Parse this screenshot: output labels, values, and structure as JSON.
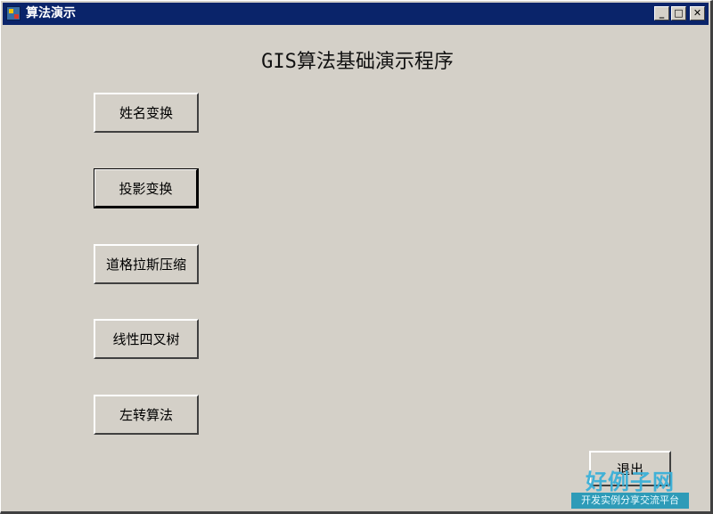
{
  "window": {
    "title": "算法演示",
    "controls": {
      "minimize": "_",
      "maximize": "□",
      "close": "✕"
    },
    "colors": {
      "titlebar": "#0a246a",
      "face": "#d4d0c8"
    }
  },
  "main": {
    "heading": "GIS算法基础演示程序",
    "buttons": [
      {
        "label": "姓名变换"
      },
      {
        "label": "投影变换"
      },
      {
        "label": "道格拉斯压缩"
      },
      {
        "label": "线性四叉树"
      },
      {
        "label": "左转算法"
      }
    ],
    "exit_label": "退出"
  },
  "watermark": {
    "logo_text": "好例子网",
    "tagline": "开发实例分享交流平台"
  }
}
